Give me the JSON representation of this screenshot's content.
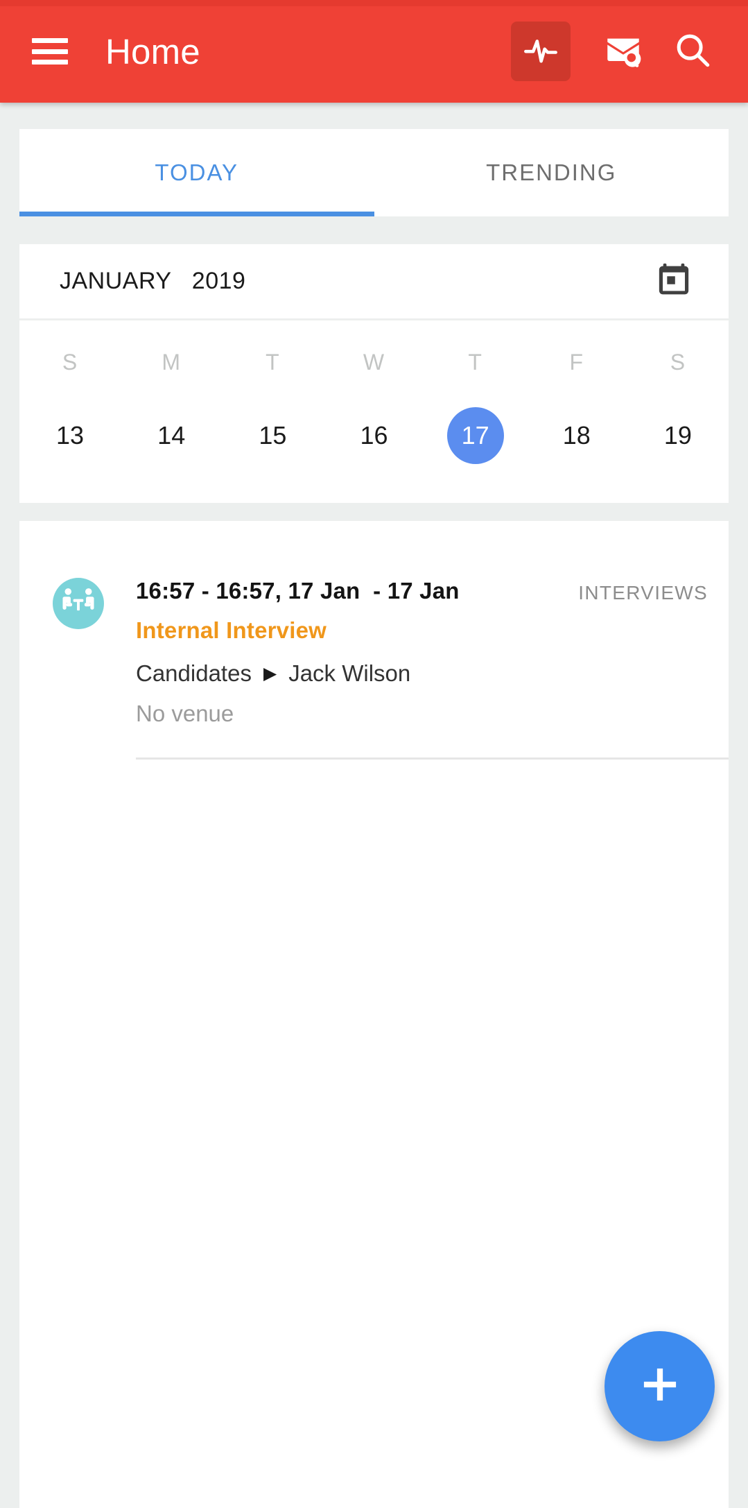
{
  "appbar": {
    "menu_icon": "hamburger-menu-icon",
    "title": "Home",
    "actions": [
      {
        "icon": "pulse-activity-icon",
        "boxed": true
      },
      {
        "icon": "mail-search-icon",
        "boxed": false
      },
      {
        "icon": "search-icon",
        "boxed": false
      }
    ],
    "background_color": "#EF4136"
  },
  "tabs": {
    "items": [
      {
        "label": "TODAY",
        "active": true
      },
      {
        "label": "TRENDING",
        "active": false
      }
    ],
    "active_color": "#4A90E2",
    "inactive_color": "#6E6E6E"
  },
  "calendar": {
    "month": "JANUARY",
    "year": "2019",
    "month_year_label": "JANUARY   2019",
    "calendar_icon": "calendar-icon",
    "day_labels": [
      "S",
      "M",
      "T",
      "W",
      "T",
      "F",
      "S"
    ],
    "dates": [
      {
        "day": "13",
        "selected": false
      },
      {
        "day": "14",
        "selected": false
      },
      {
        "day": "15",
        "selected": false
      },
      {
        "day": "16",
        "selected": false
      },
      {
        "day": "17",
        "selected": true
      },
      {
        "day": "18",
        "selected": false
      },
      {
        "day": "19",
        "selected": false
      }
    ],
    "selected_color": "#5B8DEF"
  },
  "events": [
    {
      "avatar_icon": "interview-meeting-icon",
      "avatar_color": "#7BD3D9",
      "time_range": "16:57 - 16:57, 17 Jan  - 17 Jan",
      "category": "INTERVIEWS",
      "title": "Internal Interview",
      "title_color": "#F0971B",
      "meta_label": "Candidates",
      "meta_arrow": "▶",
      "meta_value": "Jack Wilson",
      "venue": "No venue"
    }
  ],
  "fab": {
    "icon": "plus-icon",
    "color": "#3D8BEF"
  }
}
